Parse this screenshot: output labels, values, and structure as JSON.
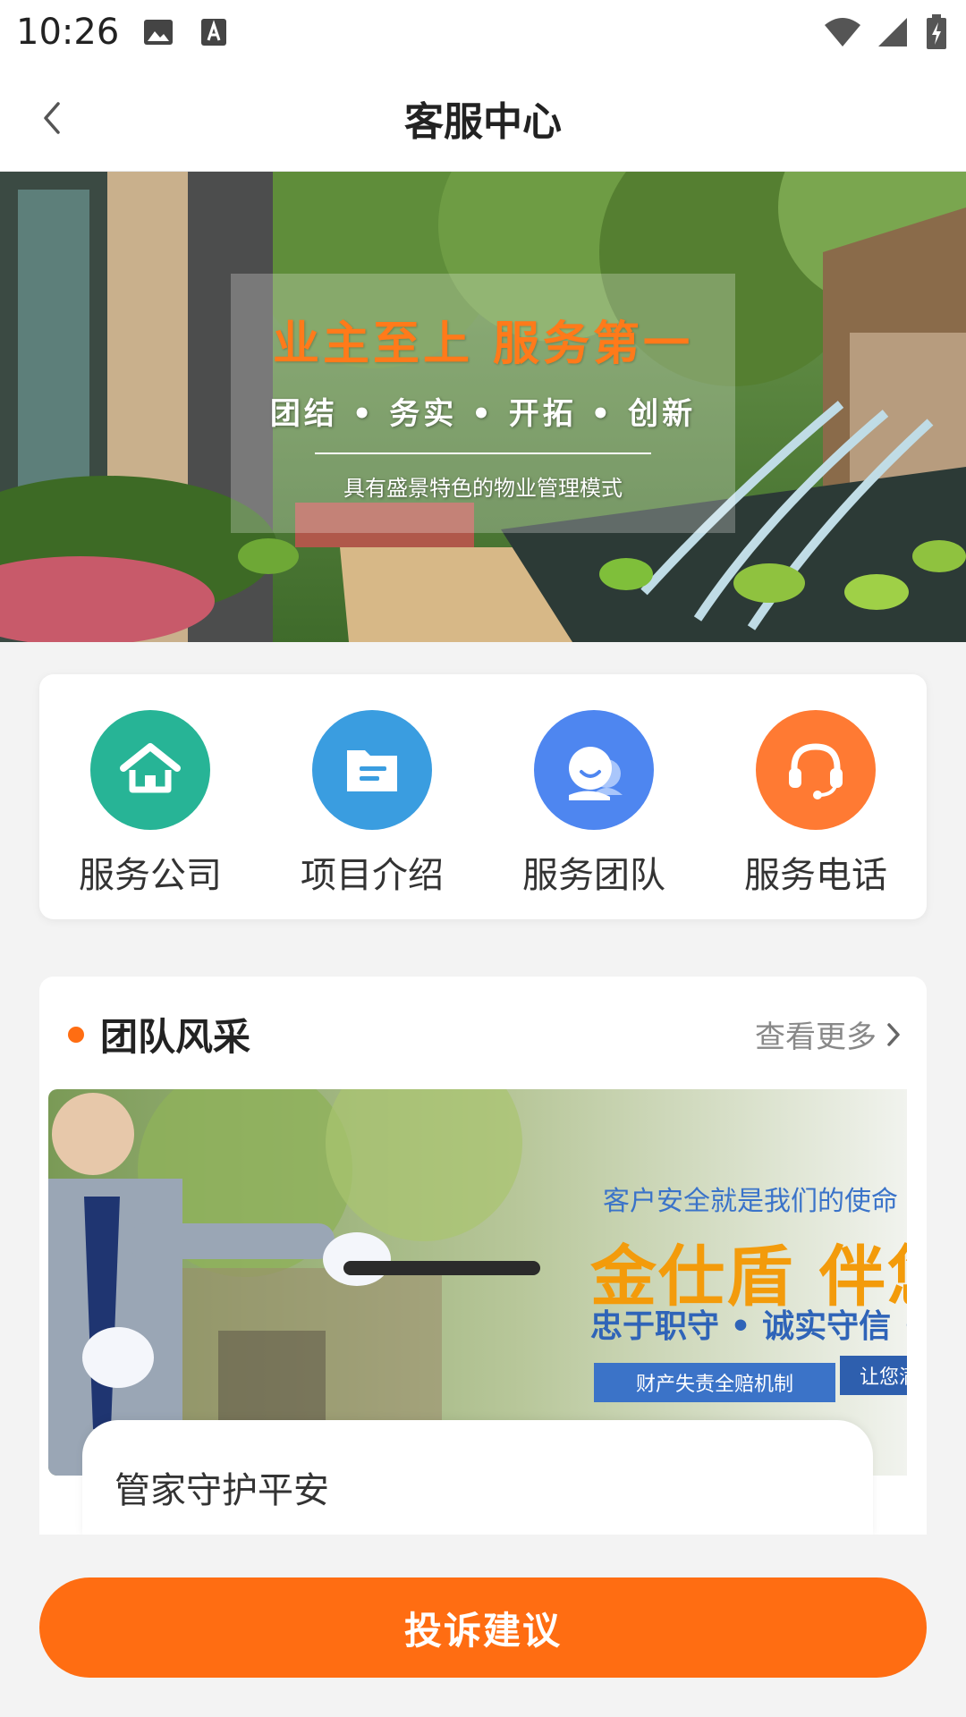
{
  "status_bar": {
    "time": "10:26",
    "icons": [
      "image-icon",
      "font-download-icon",
      "wifi-icon",
      "signal-icon",
      "battery-charging-icon"
    ]
  },
  "header": {
    "title": "客服中心",
    "back_icon": "chevron-left-icon"
  },
  "banner": {
    "headline": "业主至上  服务第一",
    "tagline": "团结 • 务实 • 开拓 • 创新",
    "subtitle": "具有盛景特色的物业管理模式"
  },
  "menu": {
    "items": [
      {
        "label": "服务公司",
        "icon": "home-icon",
        "color": "#27b496"
      },
      {
        "label": "项目介绍",
        "icon": "folder-icon",
        "color": "#3a9de0"
      },
      {
        "label": "服务团队",
        "icon": "team-icon",
        "color": "#4e86f0"
      },
      {
        "label": "服务电话",
        "icon": "headset-icon",
        "color": "#ff7a33"
      }
    ]
  },
  "team_section": {
    "title": "团队风采",
    "more_label": "查看更多",
    "image": {
      "slogan_top": "客户安全就是我们的使命",
      "slogan_big": "金仕盾 伴您",
      "slogan_mid": "忠于职守 • 诚实守信 •",
      "ribbon_left": "财产失责全赔机制",
      "ribbon_right": "让您满"
    },
    "caption": "管家守护平安"
  },
  "bottom_button": {
    "label": "投诉建议",
    "color": "#ff6d12"
  }
}
